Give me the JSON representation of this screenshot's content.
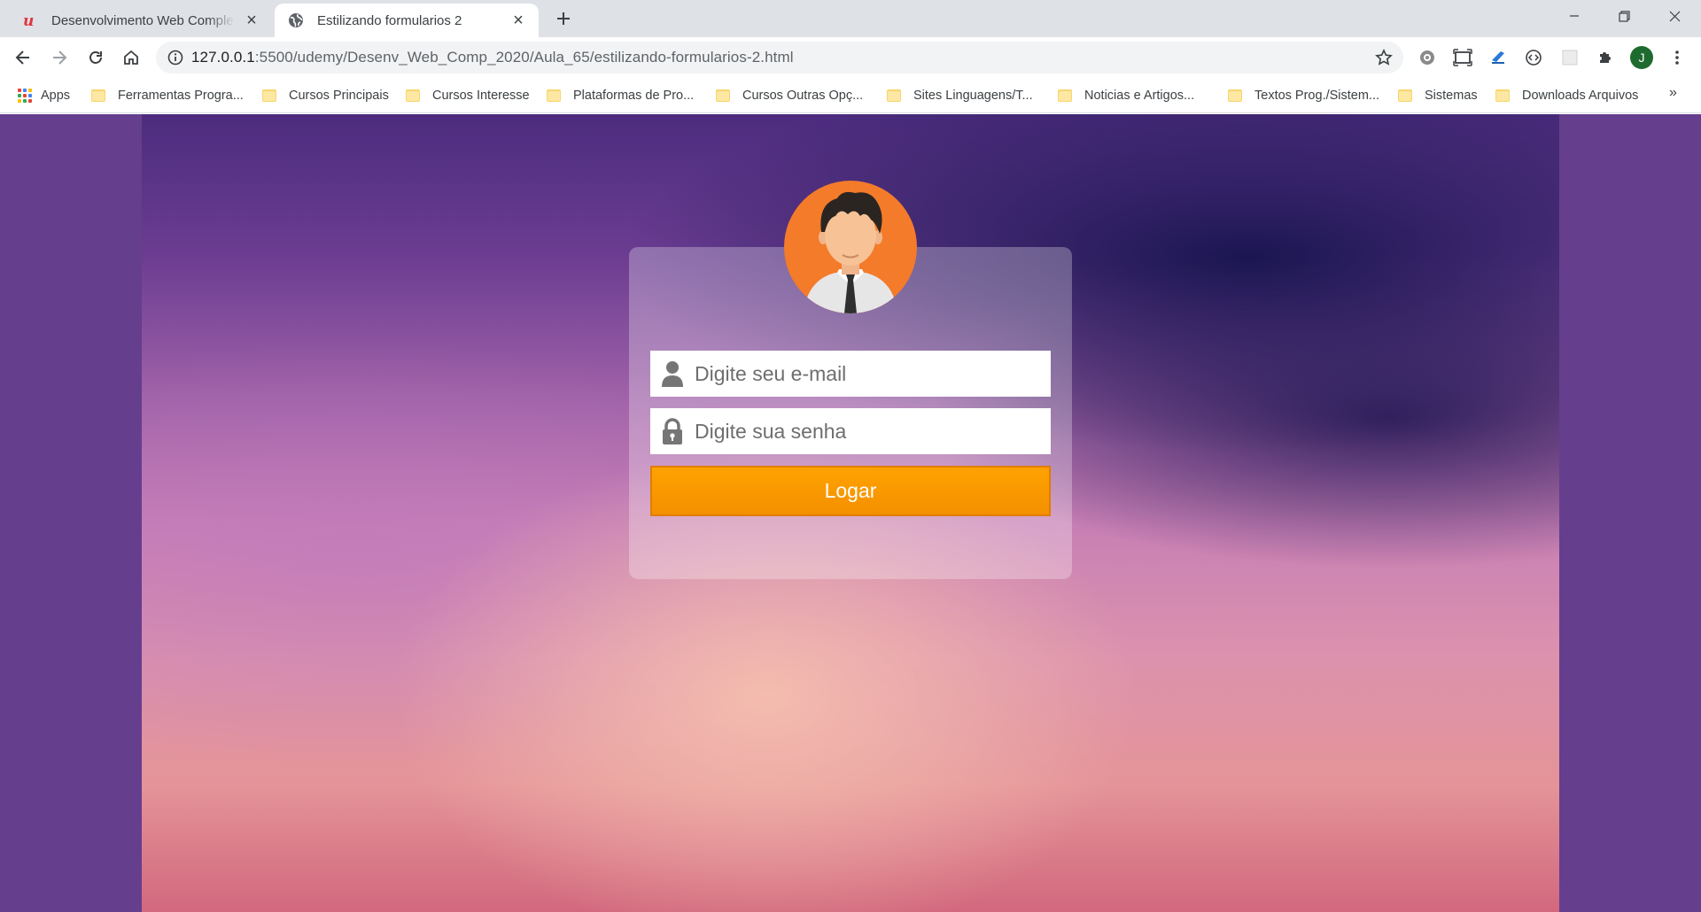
{
  "browser": {
    "tabs": [
      {
        "title": "Desenvolvimento Web Completo",
        "favicon": "udemy-icon",
        "active": false
      },
      {
        "title": "Estilizando formularios 2",
        "favicon": "globe-icon",
        "active": true
      }
    ],
    "url": {
      "host": "127.0.0.1",
      "path": ":5500/udemy/Desenv_Web_Comp_2020/Aula_65/estilizando-formularios-2.html"
    },
    "profile_initial": "J",
    "bookmarks": [
      {
        "label": "Apps",
        "icon": "apps-grid-icon"
      },
      {
        "label": "Ferramentas Progra...",
        "icon": "folder-icon"
      },
      {
        "label": "Cursos Principais",
        "icon": "folder-icon"
      },
      {
        "label": "Cursos Interesse",
        "icon": "folder-icon"
      },
      {
        "label": "Plataformas de Pro...",
        "icon": "folder-icon"
      },
      {
        "label": "Cursos Outras Opç...",
        "icon": "folder-icon"
      },
      {
        "label": "Sites Linguagens/T...",
        "icon": "folder-icon"
      },
      {
        "label": "Noticias e Artigos...",
        "icon": "folder-icon"
      },
      {
        "label": "Textos Prog./Sistem...",
        "icon": "folder-icon"
      },
      {
        "label": "Sistemas",
        "icon": "folder-icon"
      },
      {
        "label": "Downloads Arquivos",
        "icon": "folder-icon"
      }
    ],
    "more_label": "»"
  },
  "login": {
    "avatar_icon": "user-avatar-icon",
    "email_placeholder": "Digite seu e-mail",
    "password_placeholder": "Digite sua senha",
    "button_label": "Logar"
  },
  "colors": {
    "button": "#f59a00",
    "avatar_bg": "#f47b2a",
    "page_bg": "#663e8e"
  }
}
